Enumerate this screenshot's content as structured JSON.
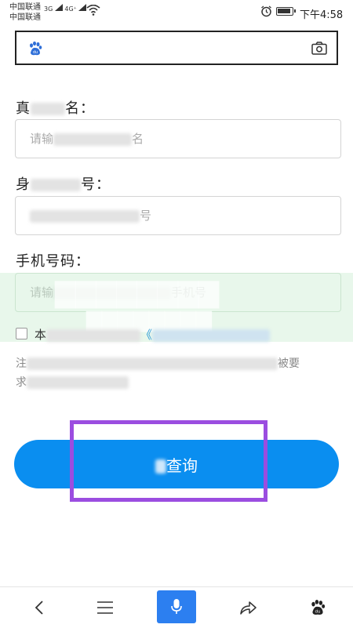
{
  "status_bar": {
    "carrier_1": "中国联通",
    "carrier_2": "中国联通",
    "network_1": "3G",
    "network_2": "4G⁺",
    "time": "下午4:58"
  },
  "search_bar": {
    "value": "",
    "logo_icon": "baidu-paw-icon",
    "camera_icon": "camera-icon"
  },
  "form": {
    "name_label_start": "真",
    "name_label_end": "名：",
    "name_placeholder_start": "请输",
    "name_placeholder_end": "名",
    "id_label_start": "身",
    "id_label_end": "号：",
    "id_placeholder_end": "号",
    "phone_label": "手机号码：",
    "phone_placeholder_start": "请输",
    "phone_placeholder_end": "手机号",
    "agree_start": "本",
    "agree_link": "《",
    "note_start": "注",
    "note_end": "被要",
    "note_line2_start": "求"
  },
  "query_button": {
    "label_end": "查询"
  },
  "bottom_nav": {
    "back_icon": "chevron-left-icon",
    "menu_icon": "menu-icon",
    "mic_icon": "microphone-icon",
    "share_icon": "share-icon",
    "home_icon": "baidu-paw-icon"
  },
  "colors": {
    "primary_button": "#0a8ef0",
    "highlight": "#9b4de0",
    "mic": "#2c7ff0",
    "link": "#2a9bd7"
  }
}
